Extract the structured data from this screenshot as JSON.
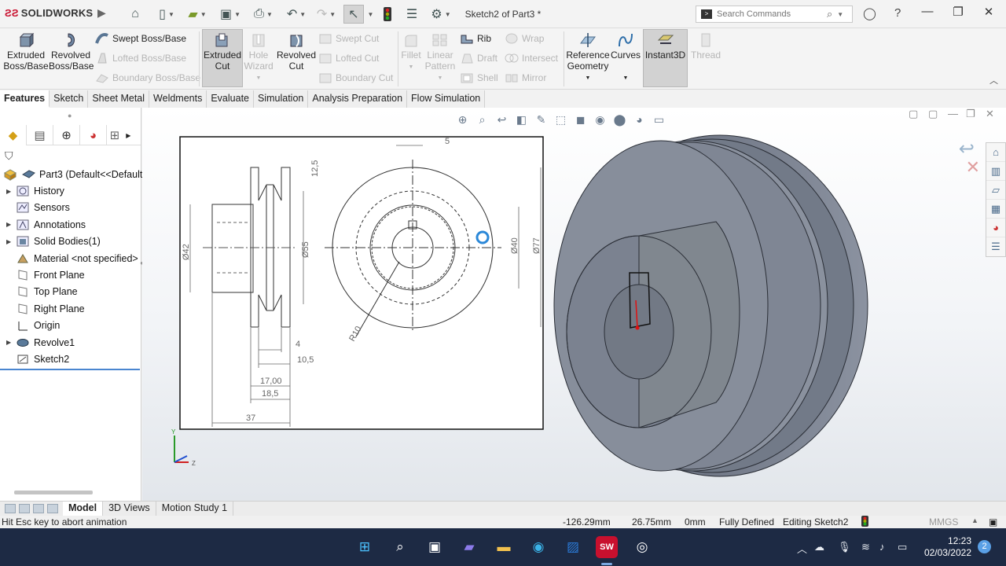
{
  "app": {
    "brand": "SOLIDWORKS",
    "document_title": "Sketch2 of Part3 *",
    "search_placeholder": "Search Commands"
  },
  "ribbon": {
    "extruded_boss": "Extruded Boss/Base",
    "revolved_boss": "Revolved Boss/Base",
    "swept_boss": "Swept Boss/Base",
    "lofted_boss": "Lofted Boss/Base",
    "boundary_boss": "Boundary Boss/Base",
    "extruded_cut": "Extruded Cut",
    "hole_wizard": "Hole Wizard",
    "revolved_cut": "Revolved Cut",
    "swept_cut": "Swept Cut",
    "lofted_cut": "Lofted Cut",
    "boundary_cut": "Boundary Cut",
    "fillet": "Fillet",
    "linear_pattern": "Linear Pattern",
    "rib": "Rib",
    "draft": "Draft",
    "shell": "Shell",
    "wrap": "Wrap",
    "intersect": "Intersect",
    "mirror": "Mirror",
    "reference_geometry": "Reference Geometry",
    "curves": "Curves",
    "instant3d": "Instant3D",
    "thread": "Thread"
  },
  "command_tabs": [
    "Features",
    "Sketch",
    "Sheet Metal",
    "Weldments",
    "Evaluate",
    "Simulation",
    "Analysis Preparation",
    "Flow Simulation"
  ],
  "tree": {
    "root": "Part3  (Default<<Default",
    "items": [
      "History",
      "Sensors",
      "Annotations",
      "Solid Bodies(1)",
      "Material <not specified>",
      "Front Plane",
      "Top Plane",
      "Right Plane",
      "Origin",
      "Revolve1",
      "Sketch2"
    ]
  },
  "drawing_dims": {
    "d5": "5",
    "d12_5": "12,5",
    "d42": "Ø42",
    "d55": "Ø55",
    "d40": "Ø40",
    "d77": "Ø77",
    "d4": "4",
    "d10_5": "10,5",
    "d17": "17,00",
    "d18_5": "18,5",
    "d37": "37",
    "r10": "R10"
  },
  "bottom_tabs": [
    "Model",
    "3D Views",
    "Motion Study 1"
  ],
  "status": {
    "message": "Hit Esc key to abort animation",
    "x": "-126.29mm",
    "y": "26.75mm",
    "z": "0mm",
    "state": "Fully Defined",
    "editing": "Editing Sketch2",
    "units": "MMGS"
  },
  "clock": {
    "time": "12:23",
    "date": "02/03/2022"
  },
  "notifications": "2",
  "colors": {
    "accent": "#c8102e",
    "part_body": "#7d8595",
    "sketch_red": "#e01010"
  }
}
